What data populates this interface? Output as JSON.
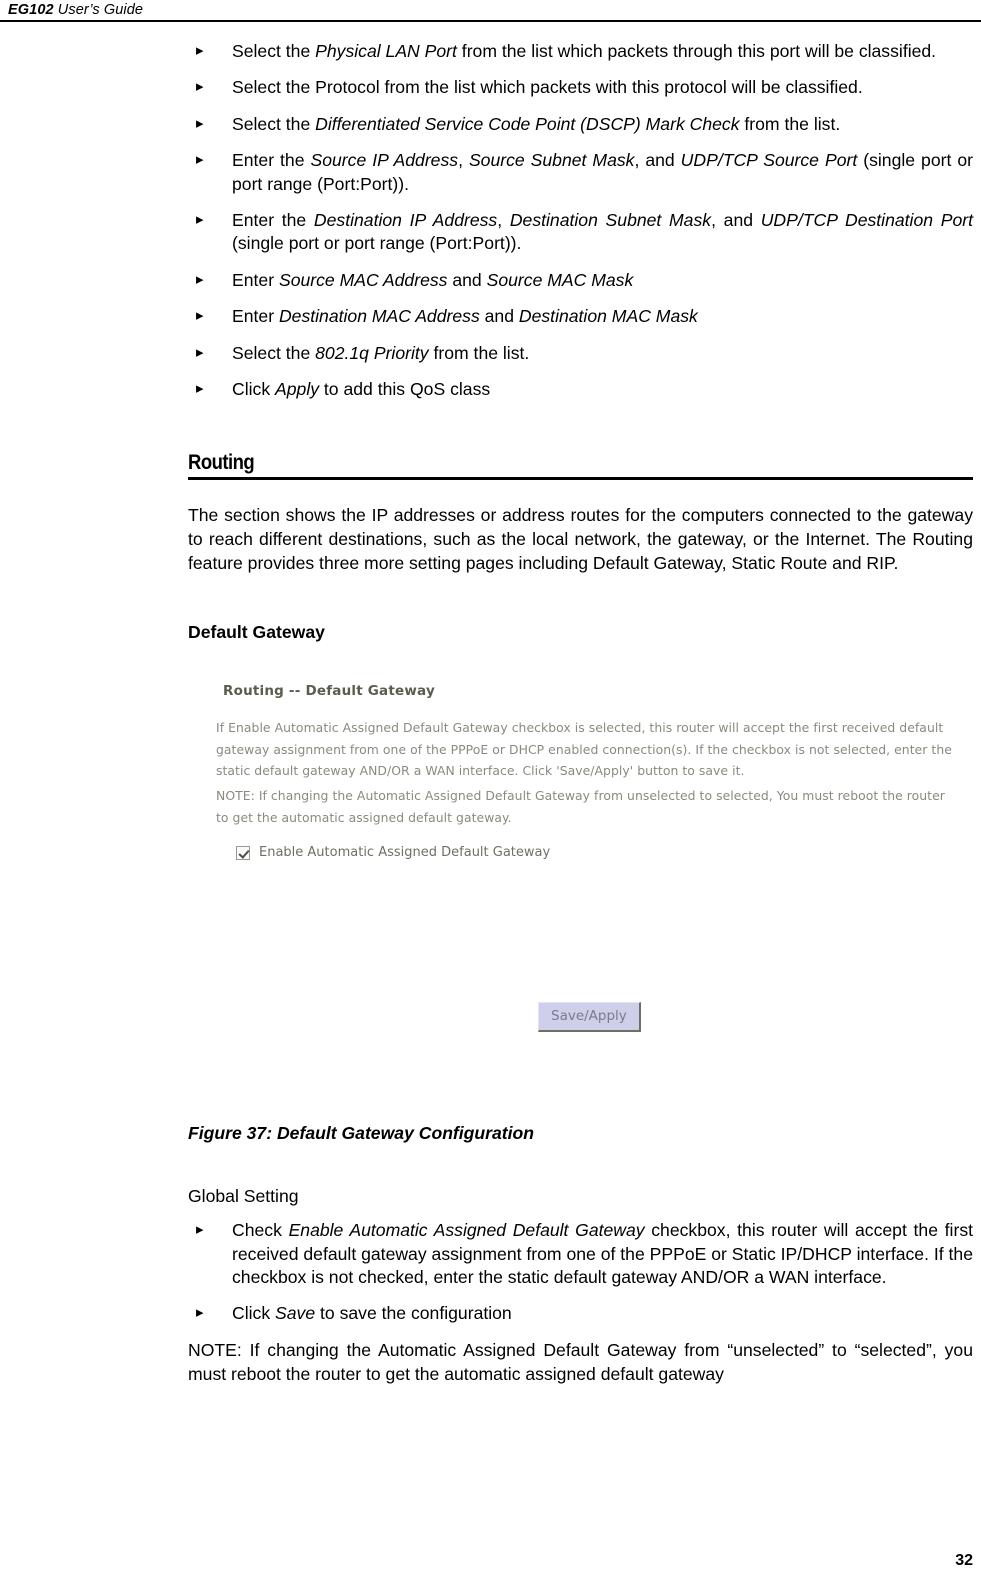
{
  "header": {
    "doc_id": "EG102",
    "doc_title": " User’s Guide"
  },
  "page_number": "32",
  "qos_steps": [
    {
      "bullet": "▸",
      "parts": [
        {
          "t": "Select the ",
          "i": false
        },
        {
          "t": "Physical LAN Port",
          "i": true
        },
        {
          "t": " from the list which packets through this port will be classified.",
          "i": false
        }
      ]
    },
    {
      "bullet": "▸",
      "parts": [
        {
          "t": "Select the Protocol from the list which packets with this protocol will be classified.",
          "i": false
        }
      ]
    },
    {
      "bullet": "▸",
      "parts": [
        {
          "t": "Select the ",
          "i": false
        },
        {
          "t": "Differentiated Service Code Point (DSCP) Mark Check",
          "i": true
        },
        {
          "t": " from the list.",
          "i": false
        }
      ]
    },
    {
      "bullet": "▸",
      "parts": [
        {
          "t": "Enter the ",
          "i": false
        },
        {
          "t": "Source IP Address",
          "i": true
        },
        {
          "t": ", ",
          "i": false
        },
        {
          "t": "Source Subnet Mask",
          "i": true
        },
        {
          "t": ", and ",
          "i": false
        },
        {
          "t": "UDP/TCP Source Port",
          "i": true
        },
        {
          "t": " (single port or port range (Port:Port)).",
          "i": false
        }
      ]
    },
    {
      "bullet": "▸",
      "parts": [
        {
          "t": "Enter the ",
          "i": false
        },
        {
          "t": "Destination IP Address",
          "i": true
        },
        {
          "t": ", ",
          "i": false
        },
        {
          "t": "Destination Subnet Mask",
          "i": true
        },
        {
          "t": ", and ",
          "i": false
        },
        {
          "t": "UDP/TCP Destination Port",
          "i": true
        },
        {
          "t": " (single port or port range (Port:Port)).",
          "i": false
        }
      ]
    },
    {
      "bullet": "▸",
      "parts": [
        {
          "t": "Enter ",
          "i": false
        },
        {
          "t": "Source MAC Address",
          "i": true
        },
        {
          "t": " and ",
          "i": false
        },
        {
          "t": "Source MAC Mask",
          "i": true
        }
      ]
    },
    {
      "bullet": "▸",
      "parts": [
        {
          "t": "Enter ",
          "i": false
        },
        {
          "t": "Destination MAC Address",
          "i": true
        },
        {
          "t": " and ",
          "i": false
        },
        {
          "t": "Destination MAC Mask",
          "i": true
        }
      ]
    },
    {
      "bullet": "▸",
      "parts": [
        {
          "t": "Select the ",
          "i": false
        },
        {
          "t": "802.1q Priority",
          "i": true
        },
        {
          "t": " from the list.",
          "i": false
        }
      ]
    },
    {
      "bullet": "▸",
      "parts": [
        {
          "t": "Click ",
          "i": false
        },
        {
          "t": "Apply",
          "i": true
        },
        {
          "t": " to add this QoS class",
          "i": false
        }
      ]
    }
  ],
  "routing_section": {
    "heading": "Routing",
    "intro": "The section shows the IP addresses or address routes for the computers connected to the gateway to reach different destinations, such as the local network, the gateway, or the Internet. The Routing feature provides three more setting pages including Default Gateway, Static Route and RIP.",
    "sub_heading": "Default Gateway"
  },
  "screenshot": {
    "title": "Routing -- Default Gateway",
    "paragraph_1": "If Enable Automatic Assigned Default Gateway checkbox is selected, this router will accept the first received default gateway assignment from one of the PPPoE or DHCP enabled connection(s). If the checkbox is not selected, enter the static default gateway AND/OR a WAN interface. Click 'Save/Apply' button to save it.",
    "paragraph_2": "NOTE: If changing the Automatic Assigned Default Gateway from unselected to selected, You must reboot the router to get the automatic assigned default gateway.",
    "checkbox_label": "Enable Automatic Assigned Default Gateway",
    "checkbox_checked": true,
    "button_label": "Save/Apply",
    "colors": {
      "button_fill": "#cfcfe9",
      "title_text": "#5b5b4e",
      "body_text": "#8a8a80"
    }
  },
  "figure_caption": "Figure 37: Default Gateway Configuration",
  "global_setting": {
    "label": "Global Setting",
    "steps": [
      {
        "bullet": "▸",
        "parts": [
          {
            "t": "Check ",
            "i": false
          },
          {
            "t": "Enable Automatic Assigned Default Gateway",
            "i": true
          },
          {
            "t": " checkbox, this router will accept the first received default gateway assignment from one of the PPPoE or Static IP/DHCP interface. If the checkbox is not checked, enter the static default gateway AND/OR a WAN interface.",
            "i": false
          }
        ]
      },
      {
        "bullet": "▸",
        "parts": [
          {
            "t": "Click ",
            "i": false
          },
          {
            "t": "Save",
            "i": true
          },
          {
            "t": " to save the configuration",
            "i": false
          }
        ]
      }
    ],
    "note": "NOTE: If changing the Automatic Assigned Default Gateway from “unselected” to “selected”, you must reboot the router to get the automatic assigned default gateway"
  }
}
